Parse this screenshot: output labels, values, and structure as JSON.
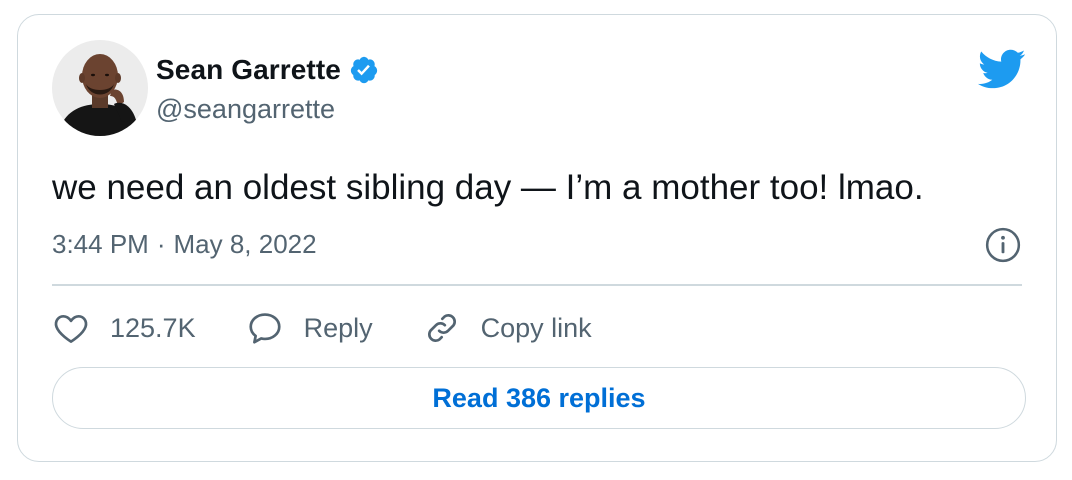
{
  "author": {
    "display_name": "Sean Garrette",
    "handle": "@seangarrette",
    "verified": true
  },
  "tweet": {
    "text": "we need an oldest sibling day — I’m a mother too! lmao.",
    "time": "3:44 PM",
    "separator": "·",
    "date": "May 8, 2022"
  },
  "actions": {
    "like_count": "125.7K",
    "reply_label": "Reply",
    "copy_link_label": "Copy link"
  },
  "read_replies_label": "Read 386 replies",
  "icons": {
    "logo": "twitter-bird-icon",
    "verified": "verified-badge-icon",
    "info": "info-icon",
    "like": "heart-icon",
    "reply": "speech-bubble-icon",
    "copy_link": "link-icon"
  },
  "colors": {
    "brand_blue": "#1d9bf0",
    "link_blue": "#006fd6",
    "text_primary": "#0f1419",
    "text_secondary": "#536471",
    "border": "#cfd9de"
  }
}
